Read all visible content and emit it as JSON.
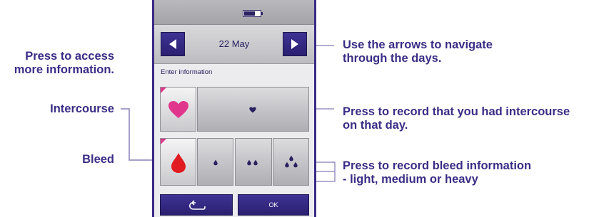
{
  "device": {
    "date": "22 May",
    "prompt": "Enter information",
    "ok_label": "OK"
  },
  "icons": {
    "battery": "battery-icon",
    "prev": "left-arrow-icon",
    "next": "right-arrow-icon",
    "heart": "heart-icon",
    "small_heart": "small-heart-icon",
    "drop": "blood-drop-icon",
    "back": "back-return-icon"
  },
  "annotations": {
    "left": {
      "access_info": "Press to access\nmore information.",
      "intercourse": "Intercourse",
      "bleed": "Bleed"
    },
    "right": {
      "arrows": "Use the arrows to navigate\nthrough the days.",
      "record_intercourse": "Press to record that you had intercourse\non that day.",
      "record_bleed": "Press to record bleed information\n- light, medium or heavy"
    }
  },
  "colors": {
    "annotation_text": "#3a2d86",
    "button_navy": "#2f2580",
    "heart_pink": "#e0378c",
    "drop_red": "#e01b22"
  }
}
